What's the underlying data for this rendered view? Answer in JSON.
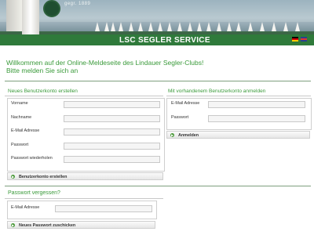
{
  "header": {
    "year_text": "gegr. 1889",
    "brand_title": "LSC SEGLER SERVICE",
    "languages": [
      "de",
      "en"
    ]
  },
  "welcome": {
    "line1": "Willkommen auf der Online-Meldeseite des Lindauer Segler-Clubs!",
    "line2": "Bitte melden Sie sich an"
  },
  "new_account": {
    "title": "Neues Benutzerkonto erstellen",
    "fields": [
      {
        "label": "Vorname",
        "value": ""
      },
      {
        "label": "Nachname",
        "value": ""
      },
      {
        "label": "E-Mail Adresse",
        "value": ""
      },
      {
        "label": "Passwort",
        "value": ""
      },
      {
        "label": "Passwort wiederholen",
        "value": ""
      }
    ],
    "button_label": "Benutzerkonto erstellen"
  },
  "login": {
    "title": "Mit vorhandenem Benutzerkonto anmelden",
    "fields": [
      {
        "label": "E-Mail Adresse",
        "value": ""
      },
      {
        "label": "Passwort",
        "value": ""
      }
    ],
    "button_label": "Anmelden"
  },
  "forgot": {
    "title": "Passwort vergessen?",
    "fields": [
      {
        "label": "E-Mail Adresse",
        "value": ""
      }
    ],
    "button_label": "Neues Passwort zuschicken"
  },
  "icons": {
    "arrow": "arrow-right-icon"
  },
  "colors": {
    "accent_green": "#3a9a3a",
    "brand_bar": "#2f7a3b"
  }
}
